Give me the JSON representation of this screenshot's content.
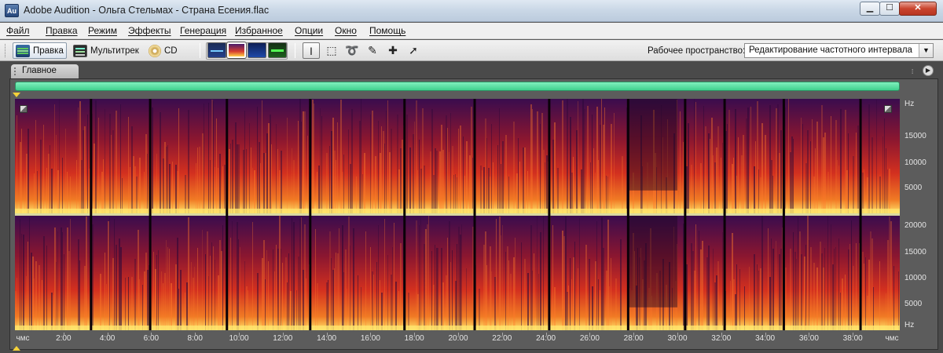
{
  "window": {
    "title": "Adobe Audition - Ольга Стельмах - Страна Есения.flac",
    "app_icon": "Au"
  },
  "menu": [
    "Файл",
    "Правка",
    "Режим",
    "Эффекты",
    "Генерация",
    "Избранное",
    "Опции",
    "Окно",
    "Помощь"
  ],
  "toolbar": {
    "edit_label": "Правка",
    "multitrack_label": "Мультитрек",
    "cd_label": "CD",
    "workspace_label": "Рабочее пространство:",
    "workspace_value": "Редактирование частотного интервала"
  },
  "panel": {
    "tab_label": "Главное"
  },
  "freq_axis": {
    "top": [
      "Hz",
      "15000",
      "10000",
      "5000"
    ],
    "bottom": [
      "20000",
      "15000",
      "10000",
      "5000",
      "Hz"
    ]
  },
  "time_axis": [
    "чмс",
    "2:00",
    "4:00",
    "6:00",
    "8:00",
    "10:00",
    "12:00",
    "14:00",
    "16:00",
    "18:00",
    "20:00",
    "22:00",
    "24:00",
    "26:00",
    "28:00",
    "30:00",
    "32:00",
    "34:00",
    "36:00",
    "38:00",
    "чмс"
  ],
  "track_boundaries_minutes": [
    3.2,
    5.9,
    9.4,
    13.2,
    17.5,
    20.7,
    24.1,
    27.7,
    30.3,
    32.1,
    34.8,
    38.3
  ],
  "colors": {
    "spectrum_low": "#1a0622",
    "spectrum_mid": "#c8281f",
    "spectrum_high": "#ffe26a",
    "overview": "#5fe3a6"
  }
}
